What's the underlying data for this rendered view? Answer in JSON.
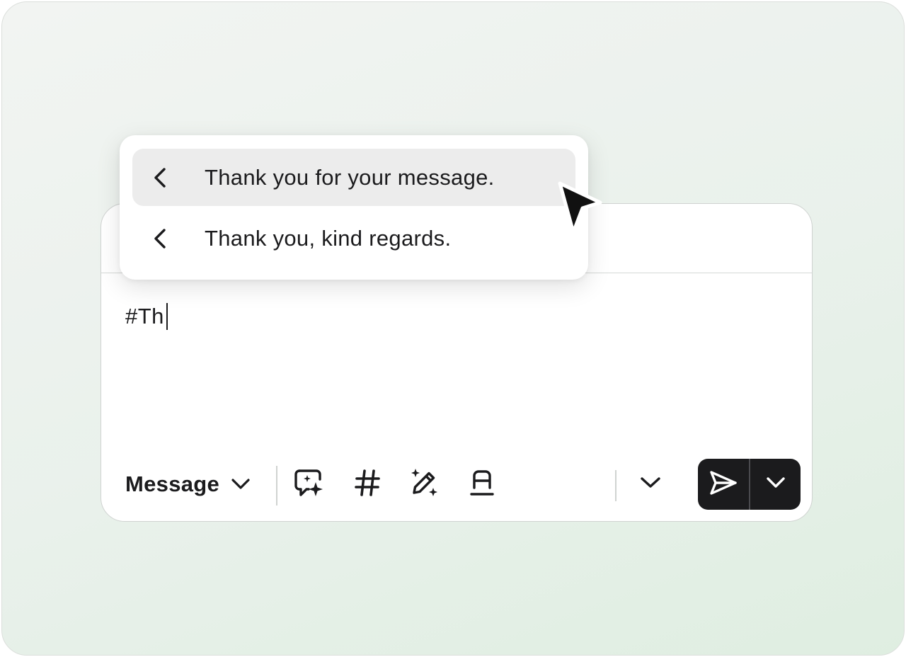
{
  "composer": {
    "input_text": "#Th",
    "mode": {
      "label": "Message",
      "chevron_icon": "chevron-down-icon"
    },
    "toolbar_icons": [
      "ai-reply-sparkle-icon",
      "hashtag-icon",
      "ai-edit-pencil-sparkle-icon",
      "text-format-icon",
      "chevron-down-icon"
    ],
    "send": {
      "icon": "send-icon",
      "more_icon": "chevron-down-icon"
    }
  },
  "suggestions": {
    "items": [
      {
        "text": "Thank you for your message.",
        "icon": "chevron-left-icon",
        "active": true
      },
      {
        "text": "Thank you, kind regards.",
        "icon": "chevron-left-icon",
        "active": false
      }
    ]
  },
  "colors": {
    "background_start": "#f2f4f2",
    "background_end": "#dfeee1",
    "primary_dark": "#1b1b1d",
    "highlight": "#ececec",
    "border": "#cfd2d0"
  }
}
